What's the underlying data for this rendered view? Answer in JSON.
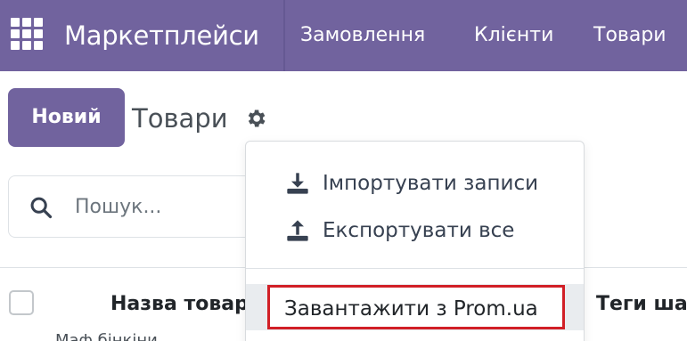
{
  "navbar": {
    "brand": "Маркетплейси",
    "items": [
      "Замовлення",
      "Клієнти",
      "Товари"
    ],
    "color": "#71639e"
  },
  "control_panel": {
    "new_button": "Новий",
    "title": "Товари"
  },
  "search": {
    "placeholder": "Пошук..."
  },
  "table": {
    "columns": [
      "Назва товар",
      "Теги ша"
    ],
    "first_row_peek": "Маф бінкіни"
  },
  "dropdown": {
    "items": [
      "Імпортувати записи",
      "Експортувати все"
    ],
    "action": "Завантажити з Prom.ua",
    "highlight_color": "#d11f26"
  },
  "icons": [
    "apps-icon",
    "gear-icon",
    "search-icon",
    "download-icon",
    "upload-icon"
  ]
}
